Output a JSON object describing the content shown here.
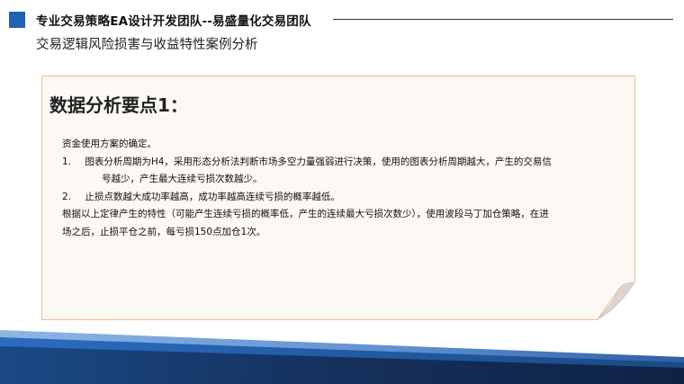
{
  "header": {
    "team_title": "专业交易策略EA设计开发团队--易盛量化交易团队",
    "subtitle": "交易逻辑风险损害与收益特性案例分析"
  },
  "card": {
    "heading": "数据分析要点1：",
    "intro": "资金使用方案的确定。",
    "items": [
      {
        "number": "1.",
        "lines": [
          "图表分析周期为H4，采用形态分析法判断市场多空力量强弱进行决策，使用的图表分析周期越大，产生的交易信",
          "号越少，产生最大连续亏损次数越少。"
        ]
      },
      {
        "number": "2.",
        "lines": [
          "止损点数越大成功率越高，成功率越高连续亏损的概率越低。"
        ]
      }
    ],
    "conclusion_lines": [
      "根据以上定律产生的特性（可能产生连续亏损的概率低，产生的连续最大亏损次数少），使用波段马丁加仓策略，在进",
      "场之后，止损平仓之前，每亏损150点加仓1次。"
    ]
  },
  "colors": {
    "brand_blue": "#1f62b5",
    "card_border": "#f0b98d",
    "card_bg": "#fcf8f3",
    "band_dark": "#16325f"
  }
}
